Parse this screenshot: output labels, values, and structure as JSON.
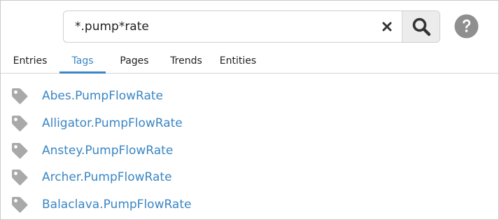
{
  "search": {
    "value": "*.pump*rate"
  },
  "icons": {
    "clear": "close-icon",
    "search": "search-icon",
    "help": "help-icon",
    "tag": "tag-icon"
  },
  "colors": {
    "accent": "#3a86c4",
    "icon_gray": "#a9a9a9",
    "help_gray": "#8f8f8f"
  },
  "tabs": [
    {
      "label": "Entries",
      "active": false
    },
    {
      "label": "Tags",
      "active": true
    },
    {
      "label": "Pages",
      "active": false
    },
    {
      "label": "Trends",
      "active": false
    },
    {
      "label": "Entities",
      "active": false
    }
  ],
  "results": [
    {
      "label": "Abes.PumpFlowRate"
    },
    {
      "label": "Alligator.PumpFlowRate"
    },
    {
      "label": "Anstey.PumpFlowRate"
    },
    {
      "label": "Archer.PumpFlowRate"
    },
    {
      "label": "Balaclava.PumpFlowRate"
    }
  ]
}
